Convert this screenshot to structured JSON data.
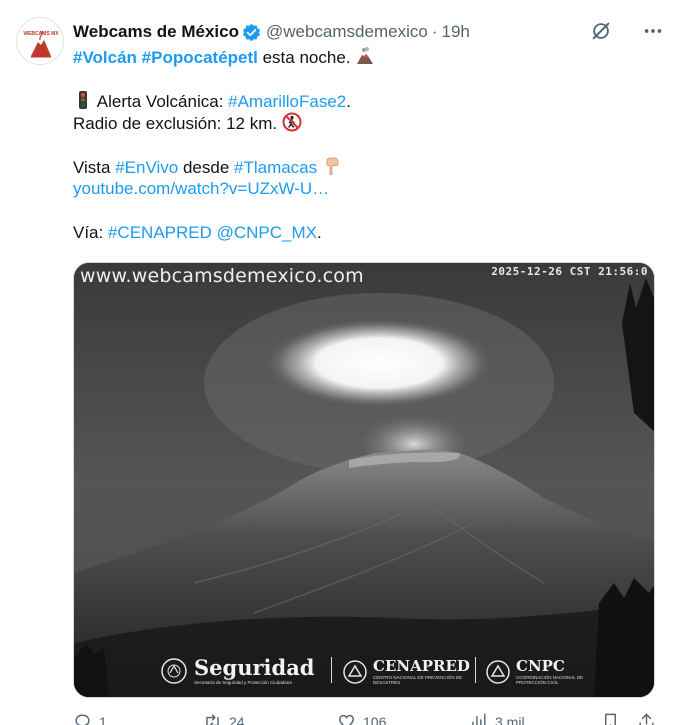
{
  "author": {
    "name": "Webcams de México",
    "handle": "@webcamsdemexico",
    "time": "19h",
    "separator": "·",
    "avatar_label": "WEBCAMS MX"
  },
  "text": {
    "l1_tag1": "#Volcán",
    "l1_tag2": "#Popocatépetl",
    "l1_rest": " esta noche.",
    "l2_pre": " Alerta Volcánica: ",
    "l2_tag": "#AmarilloFase2",
    "l2_post": ".",
    "l3": "Radio de exclusión: 12 km.",
    "l4_pre": "Vista ",
    "l4_tag1": "#EnVivo",
    "l4_mid": " desde ",
    "l4_tag2": "#Tlamacas",
    "l5_link": "youtube.com/watch?v=UZxW-U…",
    "l6_pre": "Vía: ",
    "l6_tag1": "#CENAPRED",
    "l6_tag2": "@CNPC_MX",
    "l6_post": "."
  },
  "media": {
    "watermark": "www.webcamsdemexico.com",
    "timestamp": "2025-12-26 CST 21:56:0",
    "logo1_title": "Seguridad",
    "logo1_sub": "Secretaría de Seguridad y Protección Ciudadana",
    "logo2_title": "CENAPRED",
    "logo2_sub": "CENTRO NACIONAL DE PREVENCIÓN DE DESASTRES",
    "logo3_title": "CNPC",
    "logo3_sub": "COORDINACIÓN NACIONAL DE PROTECCIÓN CIVIL"
  },
  "actions": {
    "replies": "1",
    "reposts": "24",
    "likes": "106",
    "views": "3 mil"
  },
  "colors": {
    "accent": "#1d9bf0",
    "text": "#0f1419",
    "muted": "#536471"
  }
}
